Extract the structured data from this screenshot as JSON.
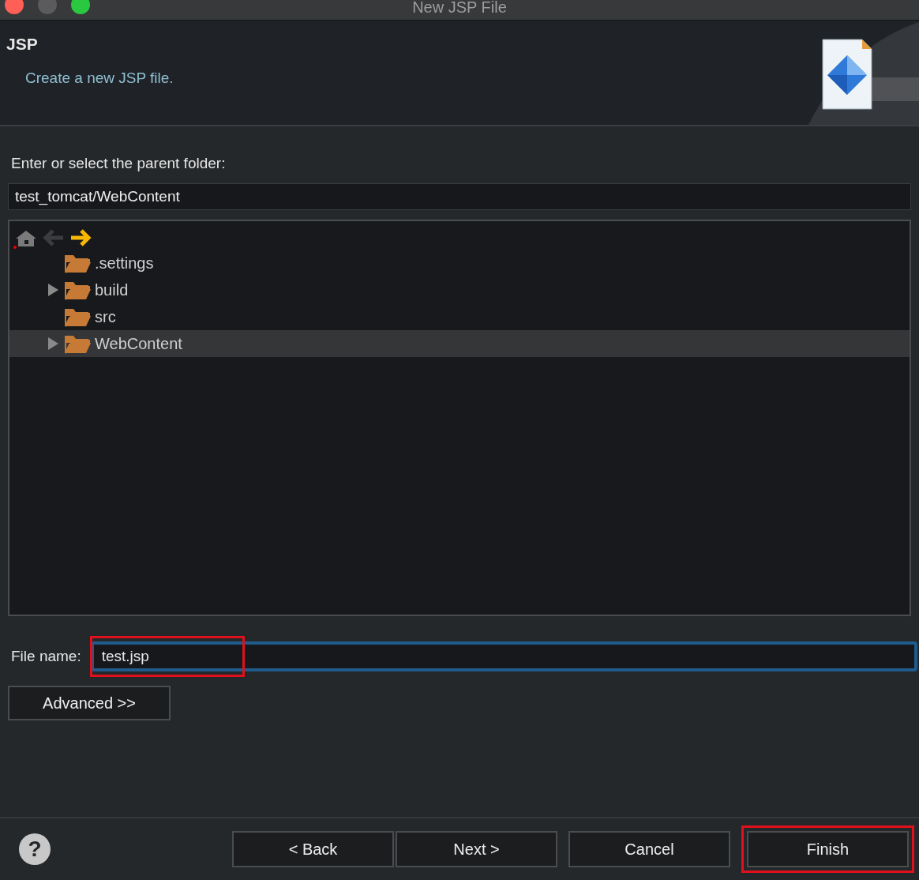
{
  "window": {
    "title": "New JSP File"
  },
  "header": {
    "title": "JSP",
    "subtitle": "Create a new JSP file."
  },
  "parent_folder": {
    "label": "Enter or select the parent folder:",
    "value": "test_tomcat/WebContent"
  },
  "tree": {
    "items": [
      {
        "label": ".settings",
        "collapsed": false,
        "selected": false
      },
      {
        "label": "build",
        "collapsed": true,
        "selected": false
      },
      {
        "label": "src",
        "collapsed": false,
        "selected": false
      },
      {
        "label": "WebContent",
        "collapsed": true,
        "selected": true
      }
    ]
  },
  "file_name": {
    "label": "File name:",
    "value": "test.jsp",
    "focused": true,
    "highlighted": true
  },
  "advanced_button": "Advanced >>",
  "help_button": "?",
  "buttons": [
    {
      "label": "< Back",
      "highlighted": false
    },
    {
      "label": "Next >",
      "highlighted": false
    },
    {
      "label": "Cancel",
      "highlighted": false
    },
    {
      "label": "Finish",
      "highlighted": true
    }
  ]
}
